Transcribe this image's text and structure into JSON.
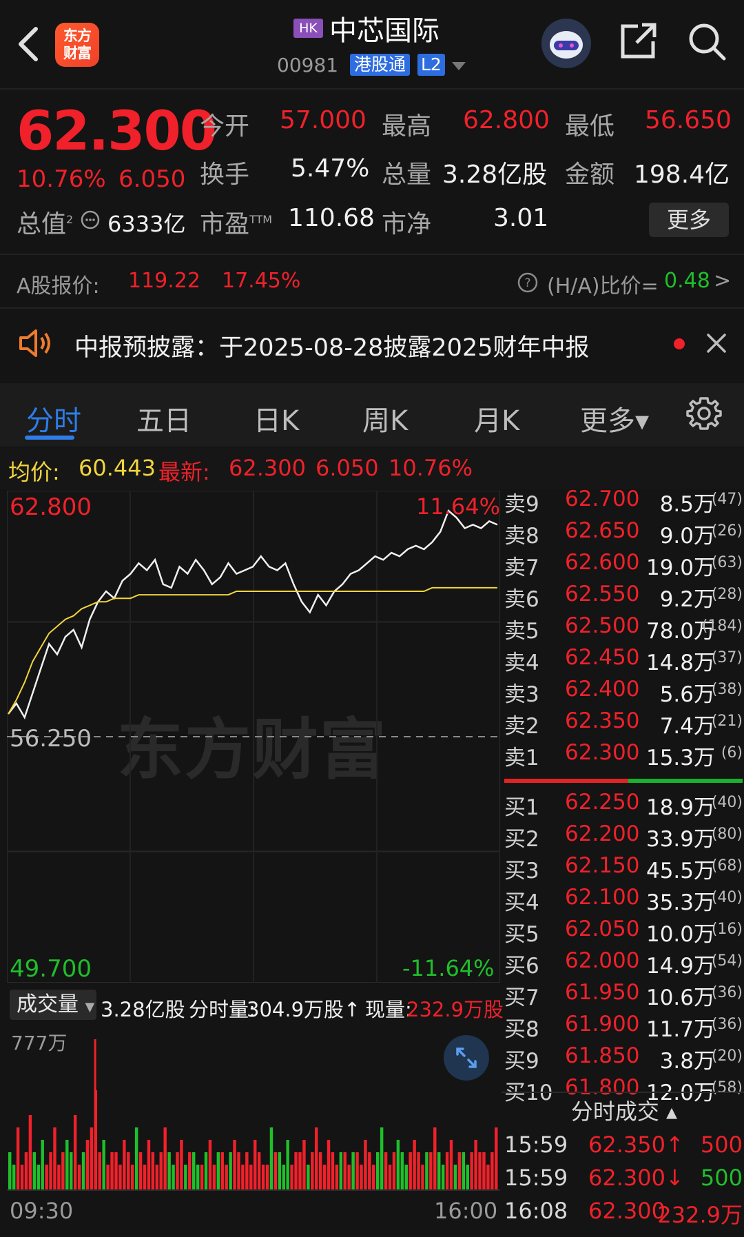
{
  "header": {
    "market_badge": "HK",
    "name": "中芯国际",
    "code": "00981",
    "connect_badge": "港股通",
    "level_badge": "L2",
    "logo_text": "东方财富",
    "icons": [
      "back-arrow-icon",
      "robot-avatar-icon",
      "share-icon",
      "search-icon"
    ]
  },
  "quote": {
    "price": "62.300",
    "change_pct": "10.76%",
    "change_amt": "6.050",
    "open_label": "今开",
    "open": "57.000",
    "high_label": "最高",
    "high": "62.800",
    "low_label": "最低",
    "low": "56.650",
    "turnover_rate_label": "换手",
    "turnover_rate": "5.47%",
    "volume_label": "总量",
    "volume": "3.28亿股",
    "amount_label": "金额",
    "amount": "198.4亿",
    "mktcap_label": "总值",
    "mktcap_sup": "2",
    "mktcap": "6333亿",
    "pe_label": "市盈",
    "pe_sup": "TTM",
    "pe": "110.68",
    "pb_label": "市净",
    "pb": "3.01",
    "more_button": "更多"
  },
  "a_share": {
    "label": "A股报价:",
    "price": "119.22",
    "premium": "17.45%",
    "ha_label": "(H/A)比价=",
    "ha_value": "0.48",
    "arrow": ">"
  },
  "notice": {
    "text": "中报预披露：于2025-08-28披露2025财年中报"
  },
  "tabs": [
    {
      "label": "分时",
      "active": true
    },
    {
      "label": "五日",
      "active": false
    },
    {
      "label": "日K",
      "active": false
    },
    {
      "label": "周K",
      "active": false
    },
    {
      "label": "月K",
      "active": false
    },
    {
      "label": "更多▾",
      "active": false
    }
  ],
  "infobar": {
    "avg_label": "均价:",
    "avg": "60.443",
    "last_label": "最新:",
    "last": "62.300",
    "chg": "6.050",
    "pct": "10.76%"
  },
  "chart_data": {
    "type": "line",
    "y_top": "62.800",
    "y_mid": "56.250",
    "y_bottom": "49.700",
    "pct_top": "11.64%",
    "pct_bottom": "-11.64%",
    "ylim": [
      49.7,
      62.8
    ],
    "watermark": "东方财富",
    "x_start": "09:30",
    "x_end": "16:00",
    "series": [
      {
        "values": [
          56.9,
          57.2,
          56.8,
          57.5,
          58.2,
          58.9,
          58.6,
          59.1,
          59.3,
          58.8,
          59.6,
          60.1,
          60.4,
          60.2,
          60.7,
          60.9,
          61.2,
          61.0,
          61.3,
          60.6,
          60.5,
          61.1,
          60.9,
          61.3,
          61.0,
          60.6,
          60.8,
          61.2,
          60.9,
          61.0,
          61.1,
          61.4,
          61.1,
          61.0,
          61.2,
          60.6,
          60.1,
          59.8,
          60.3,
          60.0,
          60.4,
          60.6,
          60.9,
          61.0,
          61.2,
          61.4,
          61.3,
          61.5,
          61.4,
          61.6,
          61.7,
          61.6,
          61.8,
          62.1,
          62.7,
          62.5,
          62.2,
          62.3,
          62.2,
          62.4,
          62.3
        ]
      },
      {
        "values": [
          56.9,
          57.3,
          57.8,
          58.4,
          58.8,
          59.2,
          59.4,
          59.6,
          59.7,
          59.9,
          60.0,
          60.1,
          60.1,
          60.2,
          60.2,
          60.2,
          60.3,
          60.3,
          60.3,
          60.3,
          60.3,
          60.3,
          60.3,
          60.3,
          60.3,
          60.3,
          60.3,
          60.3,
          60.4,
          60.4,
          60.4,
          60.4,
          60.4,
          60.4,
          60.4,
          60.4,
          60.4,
          60.4,
          60.4,
          60.4,
          60.4,
          60.4,
          60.4,
          60.4,
          60.4,
          60.4,
          60.4,
          60.4,
          60.4,
          60.4,
          60.4,
          60.4,
          60.5,
          60.5,
          60.5,
          60.5,
          60.5,
          60.5,
          60.5,
          60.5,
          60.5
        ]
      }
    ]
  },
  "volume": {
    "selector_label": "成交量",
    "total": "3.28亿股",
    "minute_label": "分时量:",
    "minute_value": "304.9万股↑",
    "current_label": "现量:",
    "current_value": "232.9万股",
    "max_label": "777万",
    "bars": [
      3,
      2,
      5,
      2,
      3,
      6,
      3,
      2,
      4,
      2,
      3,
      5,
      2,
      3,
      4,
      3,
      6,
      2,
      3,
      4,
      5,
      8,
      3,
      4,
      2,
      3,
      3,
      2,
      4,
      3,
      2,
      5,
      3,
      2,
      4,
      3,
      2,
      3,
      5,
      3,
      2,
      3,
      4,
      2,
      3,
      3,
      2,
      2,
      3,
      4,
      2,
      3,
      3,
      2,
      3,
      4,
      3,
      2,
      3,
      2,
      4,
      3,
      2,
      2,
      5,
      3,
      3,
      2,
      4,
      2,
      3,
      3,
      4,
      2,
      3,
      5,
      3,
      2,
      4,
      3,
      2,
      3,
      3,
      2,
      3,
      3,
      2,
      4,
      3,
      2,
      3,
      5,
      3,
      2,
      3,
      4,
      3,
      2,
      3,
      4,
      3,
      2,
      3,
      3,
      5,
      3,
      2,
      3,
      4,
      2,
      3,
      3,
      2,
      3,
      4,
      3,
      3,
      2,
      3,
      5
    ]
  },
  "order_book": {
    "asks": [
      {
        "label": "卖9",
        "price": "62.700",
        "vol": "8.5万",
        "cnt": "(47)"
      },
      {
        "label": "卖8",
        "price": "62.650",
        "vol": "9.0万",
        "cnt": "(26)"
      },
      {
        "label": "卖7",
        "price": "62.600",
        "vol": "19.0万",
        "cnt": "(63)"
      },
      {
        "label": "卖6",
        "price": "62.550",
        "vol": "9.2万",
        "cnt": "(28)"
      },
      {
        "label": "卖5",
        "price": "62.500",
        "vol": "78.0万",
        "cnt": "(184)"
      },
      {
        "label": "卖4",
        "price": "62.450",
        "vol": "14.8万",
        "cnt": "(37)"
      },
      {
        "label": "卖3",
        "price": "62.400",
        "vol": "5.6万",
        "cnt": "(38)"
      },
      {
        "label": "卖2",
        "price": "62.350",
        "vol": "7.4万",
        "cnt": "(21)"
      },
      {
        "label": "卖1",
        "price": "62.300",
        "vol": "15.3万",
        "cnt": "(6)"
      }
    ],
    "bids": [
      {
        "label": "买1",
        "price": "62.250",
        "vol": "18.9万",
        "cnt": "(40)"
      },
      {
        "label": "买2",
        "price": "62.200",
        "vol": "33.9万",
        "cnt": "(80)"
      },
      {
        "label": "买3",
        "price": "62.150",
        "vol": "45.5万",
        "cnt": "(68)"
      },
      {
        "label": "买4",
        "price": "62.100",
        "vol": "35.3万",
        "cnt": "(40)"
      },
      {
        "label": "买5",
        "price": "62.050",
        "vol": "10.0万",
        "cnt": "(16)"
      },
      {
        "label": "买6",
        "price": "62.000",
        "vol": "14.9万",
        "cnt": "(54)"
      },
      {
        "label": "买7",
        "price": "61.950",
        "vol": "10.6万",
        "cnt": "(36)"
      },
      {
        "label": "买8",
        "price": "61.900",
        "vol": "11.7万",
        "cnt": "(36)"
      },
      {
        "label": "买9",
        "price": "61.850",
        "vol": "3.8万",
        "cnt": "(20)"
      },
      {
        "label": "买10",
        "price": "61.800",
        "vol": "12.0万",
        "cnt": "(58)"
      }
    ]
  },
  "trades": {
    "header": "分时成交 ▴",
    "rows": [
      {
        "time": "15:59",
        "price": "62.350↑",
        "vol": "500",
        "price_color": "red",
        "vol_color": "red"
      },
      {
        "time": "15:59",
        "price": "62.300↓",
        "vol": "500",
        "price_color": "red",
        "vol_color": "green"
      },
      {
        "time": "16:08",
        "price": "62.300",
        "vol": "232.9万",
        "price_color": "red",
        "vol_color": "red"
      }
    ]
  },
  "colors": {
    "up": "#f0212a",
    "down": "#1fbf2b",
    "accent": "#2e7de8",
    "avg_line": "#f2d53c",
    "bg": "#141414"
  }
}
